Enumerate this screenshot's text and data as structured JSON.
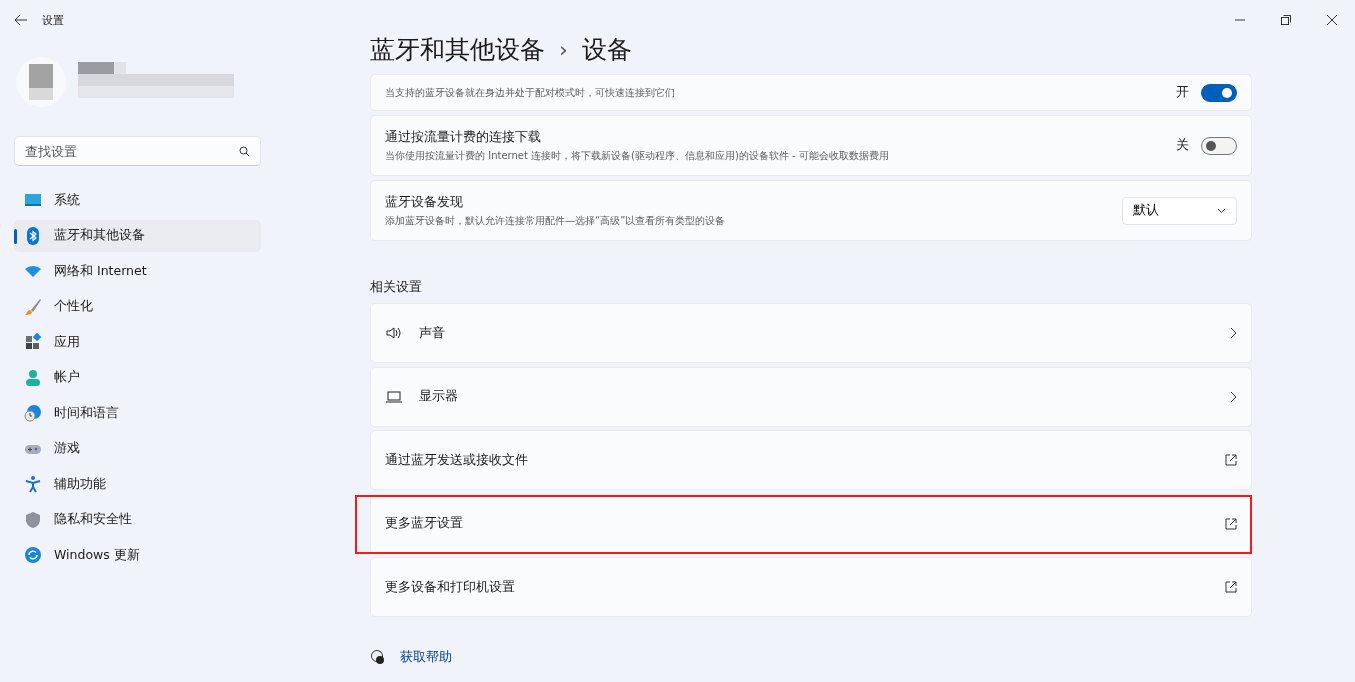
{
  "window": {
    "title": "设置"
  },
  "search": {
    "placeholder": "查找设置"
  },
  "sidebar": {
    "items": [
      {
        "label": "系统",
        "selected": false
      },
      {
        "label": "蓝牙和其他设备",
        "selected": true
      },
      {
        "label": "网络和 Internet",
        "selected": false
      },
      {
        "label": "个性化",
        "selected": false
      },
      {
        "label": "应用",
        "selected": false
      },
      {
        "label": "帐户",
        "selected": false
      },
      {
        "label": "时间和语言",
        "selected": false
      },
      {
        "label": "游戏",
        "selected": false
      },
      {
        "label": "辅助功能",
        "selected": false
      },
      {
        "label": "隐私和安全性",
        "selected": false
      },
      {
        "label": "Windows 更新",
        "selected": false
      }
    ]
  },
  "breadcrumb": {
    "parent": "蓝牙和其他设备",
    "separator": "›",
    "current": "设备"
  },
  "settings": [
    {
      "kind": "toggle",
      "description": "当支持的蓝牙设备就在身边并处于配对模式时，可快速连接到它们",
      "on": true,
      "state_label": "开"
    },
    {
      "kind": "toggle",
      "title": "通过按流量计费的连接下载",
      "description": "当你使用按流量计费的 Internet 连接时，将下载新设备(驱动程序、信息和应用)的设备软件 - 可能会收取数据费用",
      "on": false,
      "state_label": "关"
    },
    {
      "kind": "dropdown",
      "title": "蓝牙设备发现",
      "description": "添加蓝牙设备时，默认允许连接常用配件—选择“高级”以查看所有类型的设备",
      "value": "默认"
    }
  ],
  "related": {
    "heading": "相关设置",
    "items": [
      {
        "kind": "page",
        "label": "声音",
        "highlighted": false
      },
      {
        "kind": "page",
        "label": "显示器",
        "highlighted": false
      },
      {
        "kind": "external",
        "label": "通过蓝牙发送或接收文件",
        "highlighted": false
      },
      {
        "kind": "external",
        "label": "更多蓝牙设置",
        "highlighted": true
      },
      {
        "kind": "external",
        "label": "更多设备和打印机设置",
        "highlighted": false
      }
    ]
  },
  "help": {
    "label": "获取帮助"
  }
}
